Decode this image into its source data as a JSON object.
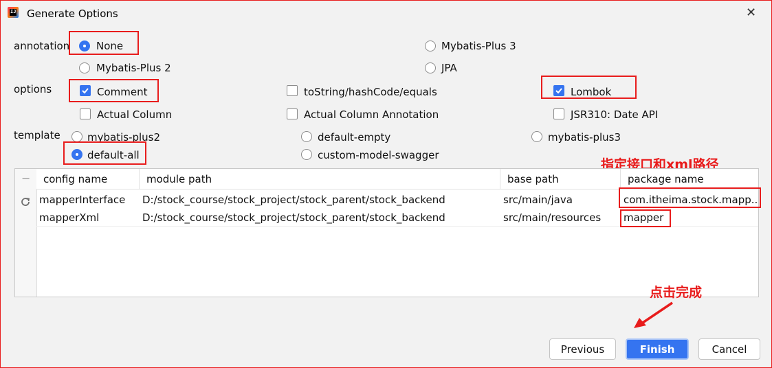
{
  "window": {
    "title": "Generate Options",
    "close_glyph": "✕"
  },
  "annotation": {
    "label": "annotation",
    "options": [
      "None",
      "Mybatis-Plus 3",
      "Mybatis-Plus 2",
      "JPA"
    ],
    "selected": "None"
  },
  "options": {
    "label": "options",
    "items": [
      {
        "label": "Comment",
        "checked": true
      },
      {
        "label": "toString/hashCode/equals",
        "checked": false
      },
      {
        "label": "Lombok",
        "checked": true
      },
      {
        "label": "Actual Column",
        "checked": false
      },
      {
        "label": "Actual Column Annotation",
        "checked": false
      },
      {
        "label": "JSR310: Date API",
        "checked": false
      }
    ]
  },
  "template": {
    "label": "template",
    "options": [
      "mybatis-plus2",
      "default-empty",
      "mybatis-plus3",
      "default-all",
      "custom-model-swagger"
    ],
    "selected": "default-all"
  },
  "table": {
    "toolbar_minus": "−",
    "columns": [
      "config name",
      "module path",
      "base path",
      "package name"
    ],
    "rows": [
      {
        "config_name": "mapperInterface",
        "module_path": "D:/stock_course/stock_project/stock_parent/stock_backend",
        "base_path": "src/main/java",
        "package_name": "com.itheima.stock.mapp..."
      },
      {
        "config_name": "mapperXml",
        "module_path": "D:/stock_course/stock_project/stock_parent/stock_backend",
        "base_path": "src/main/resources",
        "package_name": "mapper"
      }
    ]
  },
  "annotations": {
    "package_note": "指定接口和xml路径",
    "finish_note": "点击完成"
  },
  "buttons": {
    "previous": "Previous",
    "finish": "Finish",
    "cancel": "Cancel"
  },
  "colors": {
    "accent": "#3574f0",
    "highlight_red": "#e81c1c"
  },
  "icons": {
    "app": "intellij-icon",
    "refresh": "refresh-icon",
    "close": "close-icon"
  }
}
